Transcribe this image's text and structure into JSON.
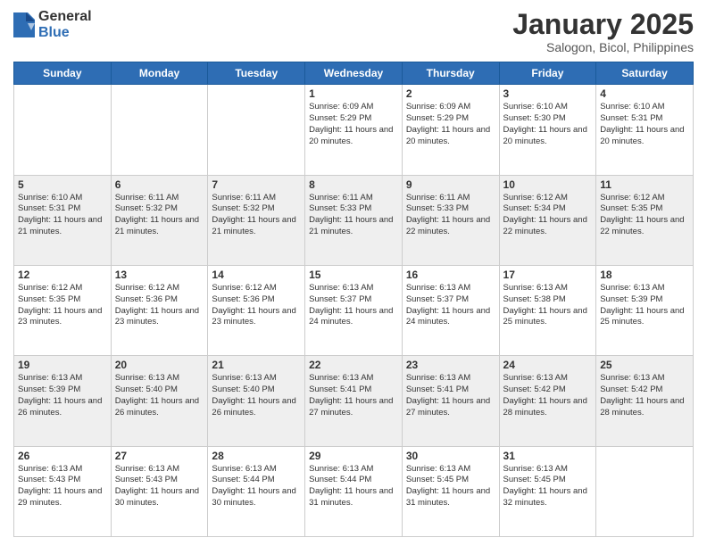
{
  "header": {
    "logo_general": "General",
    "logo_blue": "Blue",
    "month_title": "January 2025",
    "location": "Salogon, Bicol, Philippines"
  },
  "days_of_week": [
    "Sunday",
    "Monday",
    "Tuesday",
    "Wednesday",
    "Thursday",
    "Friday",
    "Saturday"
  ],
  "weeks": [
    [
      {
        "day": "",
        "info": ""
      },
      {
        "day": "",
        "info": ""
      },
      {
        "day": "",
        "info": ""
      },
      {
        "day": "1",
        "info": "Sunrise: 6:09 AM\nSunset: 5:29 PM\nDaylight: 11 hours and 20 minutes."
      },
      {
        "day": "2",
        "info": "Sunrise: 6:09 AM\nSunset: 5:29 PM\nDaylight: 11 hours and 20 minutes."
      },
      {
        "day": "3",
        "info": "Sunrise: 6:10 AM\nSunset: 5:30 PM\nDaylight: 11 hours and 20 minutes."
      },
      {
        "day": "4",
        "info": "Sunrise: 6:10 AM\nSunset: 5:31 PM\nDaylight: 11 hours and 20 minutes."
      }
    ],
    [
      {
        "day": "5",
        "info": "Sunrise: 6:10 AM\nSunset: 5:31 PM\nDaylight: 11 hours and 21 minutes."
      },
      {
        "day": "6",
        "info": "Sunrise: 6:11 AM\nSunset: 5:32 PM\nDaylight: 11 hours and 21 minutes."
      },
      {
        "day": "7",
        "info": "Sunrise: 6:11 AM\nSunset: 5:32 PM\nDaylight: 11 hours and 21 minutes."
      },
      {
        "day": "8",
        "info": "Sunrise: 6:11 AM\nSunset: 5:33 PM\nDaylight: 11 hours and 21 minutes."
      },
      {
        "day": "9",
        "info": "Sunrise: 6:11 AM\nSunset: 5:33 PM\nDaylight: 11 hours and 22 minutes."
      },
      {
        "day": "10",
        "info": "Sunrise: 6:12 AM\nSunset: 5:34 PM\nDaylight: 11 hours and 22 minutes."
      },
      {
        "day": "11",
        "info": "Sunrise: 6:12 AM\nSunset: 5:35 PM\nDaylight: 11 hours and 22 minutes."
      }
    ],
    [
      {
        "day": "12",
        "info": "Sunrise: 6:12 AM\nSunset: 5:35 PM\nDaylight: 11 hours and 23 minutes."
      },
      {
        "day": "13",
        "info": "Sunrise: 6:12 AM\nSunset: 5:36 PM\nDaylight: 11 hours and 23 minutes."
      },
      {
        "day": "14",
        "info": "Sunrise: 6:12 AM\nSunset: 5:36 PM\nDaylight: 11 hours and 23 minutes."
      },
      {
        "day": "15",
        "info": "Sunrise: 6:13 AM\nSunset: 5:37 PM\nDaylight: 11 hours and 24 minutes."
      },
      {
        "day": "16",
        "info": "Sunrise: 6:13 AM\nSunset: 5:37 PM\nDaylight: 11 hours and 24 minutes."
      },
      {
        "day": "17",
        "info": "Sunrise: 6:13 AM\nSunset: 5:38 PM\nDaylight: 11 hours and 25 minutes."
      },
      {
        "day": "18",
        "info": "Sunrise: 6:13 AM\nSunset: 5:39 PM\nDaylight: 11 hours and 25 minutes."
      }
    ],
    [
      {
        "day": "19",
        "info": "Sunrise: 6:13 AM\nSunset: 5:39 PM\nDaylight: 11 hours and 26 minutes."
      },
      {
        "day": "20",
        "info": "Sunrise: 6:13 AM\nSunset: 5:40 PM\nDaylight: 11 hours and 26 minutes."
      },
      {
        "day": "21",
        "info": "Sunrise: 6:13 AM\nSunset: 5:40 PM\nDaylight: 11 hours and 26 minutes."
      },
      {
        "day": "22",
        "info": "Sunrise: 6:13 AM\nSunset: 5:41 PM\nDaylight: 11 hours and 27 minutes."
      },
      {
        "day": "23",
        "info": "Sunrise: 6:13 AM\nSunset: 5:41 PM\nDaylight: 11 hours and 27 minutes."
      },
      {
        "day": "24",
        "info": "Sunrise: 6:13 AM\nSunset: 5:42 PM\nDaylight: 11 hours and 28 minutes."
      },
      {
        "day": "25",
        "info": "Sunrise: 6:13 AM\nSunset: 5:42 PM\nDaylight: 11 hours and 28 minutes."
      }
    ],
    [
      {
        "day": "26",
        "info": "Sunrise: 6:13 AM\nSunset: 5:43 PM\nDaylight: 11 hours and 29 minutes."
      },
      {
        "day": "27",
        "info": "Sunrise: 6:13 AM\nSunset: 5:43 PM\nDaylight: 11 hours and 30 minutes."
      },
      {
        "day": "28",
        "info": "Sunrise: 6:13 AM\nSunset: 5:44 PM\nDaylight: 11 hours and 30 minutes."
      },
      {
        "day": "29",
        "info": "Sunrise: 6:13 AM\nSunset: 5:44 PM\nDaylight: 11 hours and 31 minutes."
      },
      {
        "day": "30",
        "info": "Sunrise: 6:13 AM\nSunset: 5:45 PM\nDaylight: 11 hours and 31 minutes."
      },
      {
        "day": "31",
        "info": "Sunrise: 6:13 AM\nSunset: 5:45 PM\nDaylight: 11 hours and 32 minutes."
      },
      {
        "day": "",
        "info": ""
      }
    ]
  ]
}
